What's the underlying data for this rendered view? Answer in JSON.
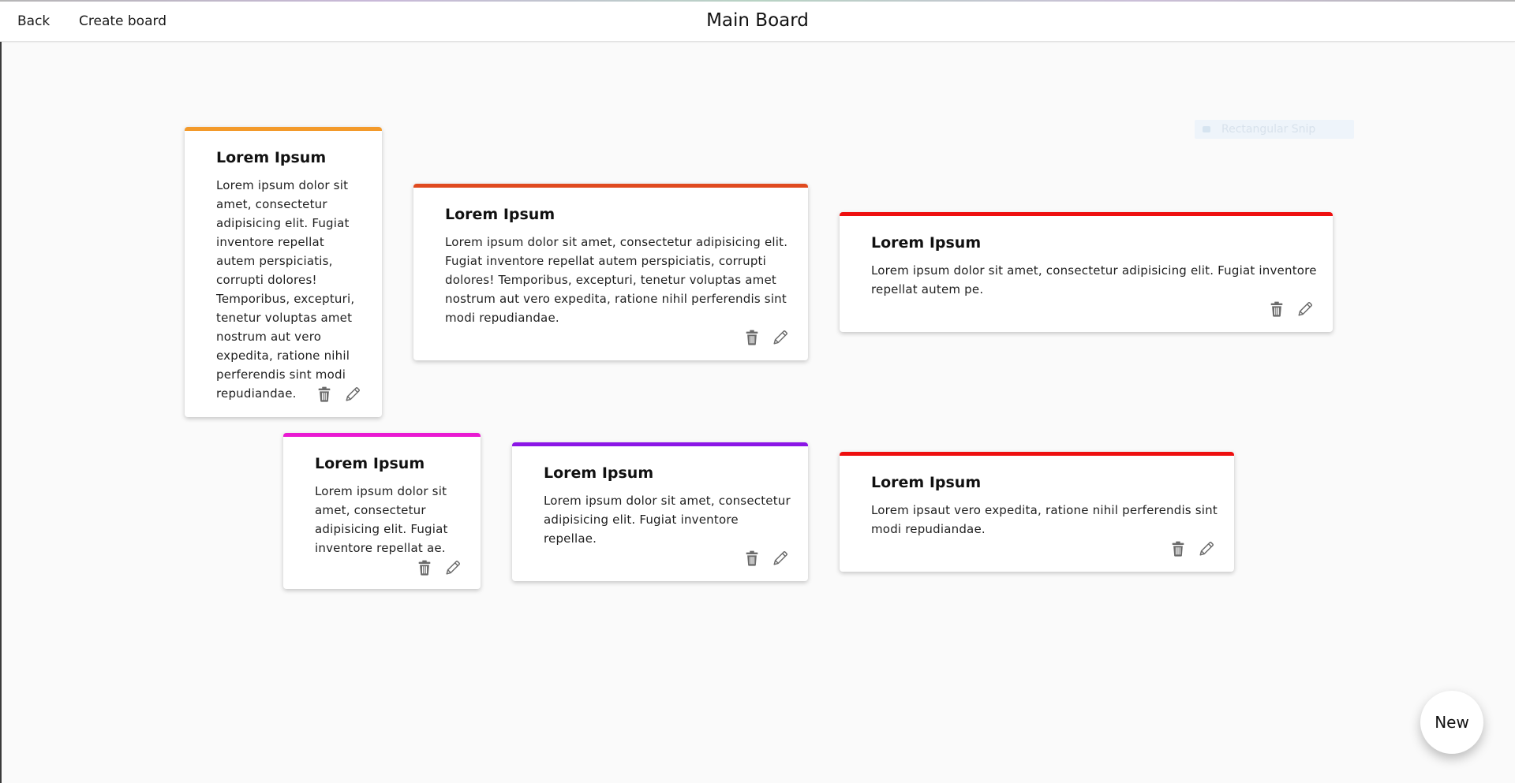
{
  "nav": {
    "back_label": "Back",
    "create_board_label": "Create board"
  },
  "page_title": "Main Board",
  "snip_tool": {
    "label": "Rectangular Snip"
  },
  "fab": {
    "label": "New"
  },
  "cards": [
    {
      "title": "Lorem Ipsum",
      "body": "Lorem ipsum dolor sit amet, consectetur adipisicing elit. Fugiat inventore repellat autem perspiciatis, corrupti dolores! Temporibus, excepturi, tenetur voluptas amet nostrum aut vero expedita, ratione nihil perferendis sint modi repudiandae.",
      "accent_color": "#f39a2b",
      "actions": [
        "trash-icon",
        "pencil-icon"
      ]
    },
    {
      "title": "Lorem Ipsum",
      "body": "Lorem ipsum dolor sit amet, consectetur adipisicing elit. Fugiat inventore repellat autem perspiciatis, corrupti dolores! Temporibus, excepturi, tenetur voluptas amet nostrum aut vero expedita, ratione nihil perferendis sint modi repudiandae.",
      "accent_color": "#e04a1f",
      "actions": [
        "trash-icon",
        "pencil-icon"
      ]
    },
    {
      "title": "Lorem Ipsum",
      "body": "Lorem ipsum dolor sit amet, consectetur adipisicing elit. Fugiat inventore repellat autem pe.",
      "accent_color": "#ee0f0f",
      "actions": [
        "trash-icon",
        "pencil-icon"
      ]
    },
    {
      "title": "Lorem Ipsum",
      "body": "Lorem ipsum dolor sit amet, consectetur adipisicing elit. Fugiat inventore repellat ae.",
      "accent_color": "#e91ad2",
      "actions": [
        "trash-icon",
        "pencil-icon"
      ]
    },
    {
      "title": "Lorem Ipsum",
      "body": "Lorem ipsum dolor sit amet, consectetur adipisicing elit. Fugiat inventore repellae.",
      "accent_color": "#8b16e6",
      "actions": [
        "trash-icon",
        "pencil-icon"
      ]
    },
    {
      "title": "Lorem Ipsum",
      "body": "Lorem ipsaut vero expedita, ratione nihil perferendis sint modi repudiandae.",
      "accent_color": "#ee0f0f",
      "actions": [
        "trash-icon",
        "pencil-icon"
      ]
    }
  ]
}
